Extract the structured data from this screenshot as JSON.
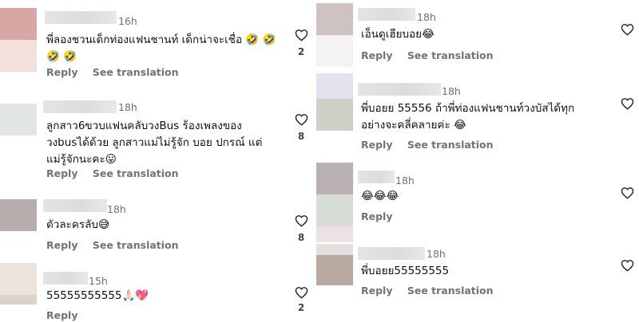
{
  "common": {
    "reply_label": "Reply",
    "translate_label": "See translation"
  },
  "left_comments": [
    {
      "time": "16h",
      "text": "พี่ลองชวนเด็กท่องแฟนชานท์ เด็กน่าจะเชื่อ 🤣 🤣\n🤣 🤣",
      "likes": "2"
    },
    {
      "time": "18h",
      "text": "ลูกสาว6ขวบแฟนคลับวงBus ร้องเพลงของ\nวงbusได้ด้วย  ลูกสาวแม่ไม่รู้จัก บอย ปกรณ์  แต่\nแม่รู้จักนะคะ😛",
      "likes": "8"
    },
    {
      "time": "18h",
      "text": "ตัวละครลับ😅",
      "likes": "8"
    },
    {
      "time": "15h",
      "text": "55555555555🙏🏻💖",
      "likes": "2"
    }
  ],
  "right_comments": [
    {
      "time": "18h",
      "text": "เอ็นดูเฮียบอย😂",
      "likes": ""
    },
    {
      "time": "18h",
      "text": "พี่บอยย 55556 ถ้าพี่ท่องแฟนชานท์วงบัสได้ทุก\nอย่างจะคลี่คลายค่ะ 😂",
      "likes": ""
    },
    {
      "time": "18h",
      "text": "😂😂😂",
      "likes": ""
    },
    {
      "time": "18h",
      "text": "พี่บอยย55555555",
      "likes": ""
    }
  ],
  "colors": {
    "action_gray": "#737373",
    "time_gray": "#6f6f6f"
  }
}
